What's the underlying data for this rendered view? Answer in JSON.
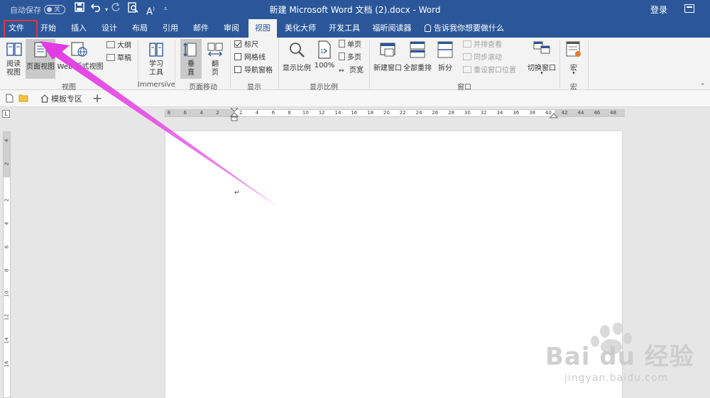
{
  "title_bar": {
    "autosave_label": "自动保存",
    "autosave_state": "关",
    "document_title": "新建 Microsoft Word 文档 (2).docx  -  Word",
    "login_label": "登录",
    "quick_access": [
      "save-icon",
      "undo-icon",
      "redo-icon",
      "print-preview-icon",
      "read-aloud-icon",
      "customize-icon"
    ]
  },
  "tabs": [
    {
      "label": "文件",
      "active": false,
      "highlighted": true
    },
    {
      "label": "开始",
      "active": false
    },
    {
      "label": "插入",
      "active": false
    },
    {
      "label": "设计",
      "active": false
    },
    {
      "label": "布局",
      "active": false
    },
    {
      "label": "引用",
      "active": false
    },
    {
      "label": "邮件",
      "active": false
    },
    {
      "label": "审阅",
      "active": false
    },
    {
      "label": "视图",
      "active": true
    },
    {
      "label": "美化大师",
      "active": false
    },
    {
      "label": "开发工具",
      "active": false
    },
    {
      "label": "福昕阅读器",
      "active": false
    }
  ],
  "tell_me": "告诉我你想要做什么",
  "ribbon": {
    "views": {
      "label": "视图",
      "read_mode": "阅读\n视图",
      "print_layout": "页面视图",
      "web_layout": "Web 版式视图",
      "outline": "大纲",
      "draft": "草稿"
    },
    "immersive": {
      "label": "Immersive",
      "learning_tools": "学习\n工具"
    },
    "page_movement": {
      "label": "页面移动",
      "vertical": "垂\n直",
      "side_to_side": "翻\n页"
    },
    "show": {
      "label": "显示",
      "ruler": {
        "label": "标尺",
        "checked": true
      },
      "gridlines": {
        "label": "网格线",
        "checked": false
      },
      "nav_pane": {
        "label": "导航窗格",
        "checked": false
      }
    },
    "zoom": {
      "label": "显示比例",
      "zoom": "显示比例",
      "hundred": "100%",
      "one_page": "单页",
      "multi_page": "多页",
      "page_width": "页宽"
    },
    "window": {
      "label": "窗口",
      "new_window": "新建窗口",
      "arrange_all": "全部重排",
      "split": "拆分",
      "side_by_side": "并排查看",
      "sync_scroll": "同步滚动",
      "reset_position": "重设窗口位置",
      "switch_windows": "切换窗口"
    },
    "macros": {
      "label": "宏",
      "macros": "宏"
    }
  },
  "doc_tabs": {
    "template_zone": "模板专区",
    "add": "+"
  },
  "ruler": {
    "h_ticks": [
      "8",
      "6",
      "4",
      "2",
      "2",
      "4",
      "6",
      "8",
      "10",
      "12",
      "14",
      "16",
      "18",
      "20",
      "22",
      "24",
      "26",
      "28",
      "30",
      "32",
      "34",
      "36",
      "38",
      "40",
      "42",
      "44",
      "46",
      "48"
    ],
    "v_ticks": [
      "4",
      "2",
      "2",
      "4",
      "6",
      "8",
      "10",
      "12",
      "14",
      "16"
    ],
    "corner": "L"
  },
  "watermark": {
    "text": "Bai du 经验",
    "sub": "jingyan.baidu.com"
  },
  "colors": {
    "title_blue": "#2b579a",
    "highlight_red": "#e0353c",
    "arrow_magenta": "#e33be3"
  }
}
